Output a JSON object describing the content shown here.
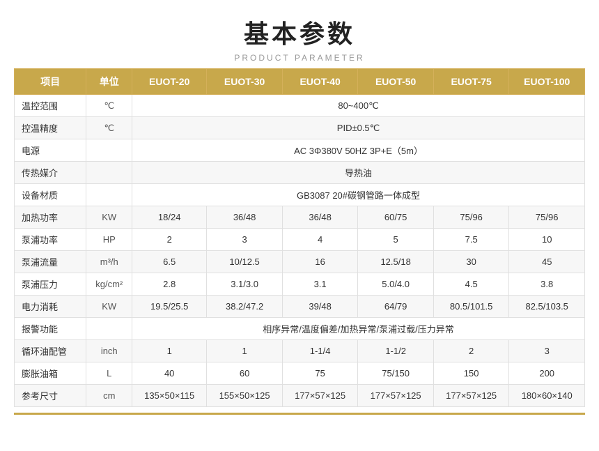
{
  "header": {
    "main_title": "基本参数",
    "sub_title": "PRODUCT PARAMETER"
  },
  "table": {
    "headers": [
      "项目",
      "单位",
      "EUOT-20",
      "EUOT-30",
      "EUOT-40",
      "EUOT-50",
      "EUOT-75",
      "EUOT-100"
    ],
    "rows": [
      {
        "label": "温控范围",
        "unit": "℃",
        "values": [
          "80~400℃",
          "",
          "",
          "",
          "",
          ""
        ]
      },
      {
        "label": "控温精度",
        "unit": "℃",
        "values": [
          "PID±0.5℃",
          "",
          "",
          "",
          "",
          ""
        ]
      },
      {
        "label": "电源",
        "unit": "",
        "values": [
          "AC 3Φ380V 50HZ 3P+E（5m）",
          "",
          "",
          "",
          "",
          ""
        ]
      },
      {
        "label": "传热媒介",
        "unit": "",
        "values": [
          "导热油",
          "",
          "",
          "",
          "",
          ""
        ]
      },
      {
        "label": "设备材质",
        "unit": "",
        "values": [
          "GB3087   20#碳钢管路一体成型",
          "",
          "",
          "",
          "",
          ""
        ]
      },
      {
        "label": "加热功率",
        "unit": "KW",
        "values": [
          "18/24",
          "36/48",
          "36/48",
          "60/75",
          "75/96",
          "75/96"
        ]
      },
      {
        "label": "泵浦功率",
        "unit": "HP",
        "values": [
          "2",
          "3",
          "4",
          "5",
          "7.5",
          "10"
        ]
      },
      {
        "label": "泵浦流量",
        "unit": "m³/h",
        "values": [
          "6.5",
          "10/12.5",
          "16",
          "12.5/18",
          "30",
          "45"
        ]
      },
      {
        "label": "泵浦压力",
        "unit": "kg/cm²",
        "values": [
          "2.8",
          "3.1/3.0",
          "3.1",
          "5.0/4.0",
          "4.5",
          "3.8"
        ]
      },
      {
        "label": "电力消耗",
        "unit": "KW",
        "values": [
          "19.5/25.5",
          "38.2/47.2",
          "39/48",
          "64/79",
          "80.5/101.5",
          "82.5/103.5"
        ]
      },
      {
        "label": "报警功能",
        "unit": "",
        "values": [
          "相序异常/温度偏差/加热异常/泵浦过载/压力异常",
          "",
          "",
          "",
          "",
          ""
        ]
      },
      {
        "label": "循环油配管",
        "unit": "inch",
        "values": [
          "1",
          "1",
          "1-1/4",
          "1-1/2",
          "2",
          "3"
        ]
      },
      {
        "label": "膨胀油箱",
        "unit": "L",
        "values": [
          "40",
          "60",
          "75",
          "75/150",
          "150",
          "200"
        ]
      },
      {
        "label": "参考尺寸",
        "unit": "cm",
        "values": [
          "135×50×115",
          "155×50×125",
          "177×57×125",
          "177×57×125",
          "177×57×125",
          "180×60×140"
        ]
      }
    ],
    "colspan_rows": [
      0,
      1,
      2,
      3,
      4,
      10
    ],
    "unit_col2": {
      "temp_range": "℃",
      "temp_precision": "℃"
    }
  }
}
